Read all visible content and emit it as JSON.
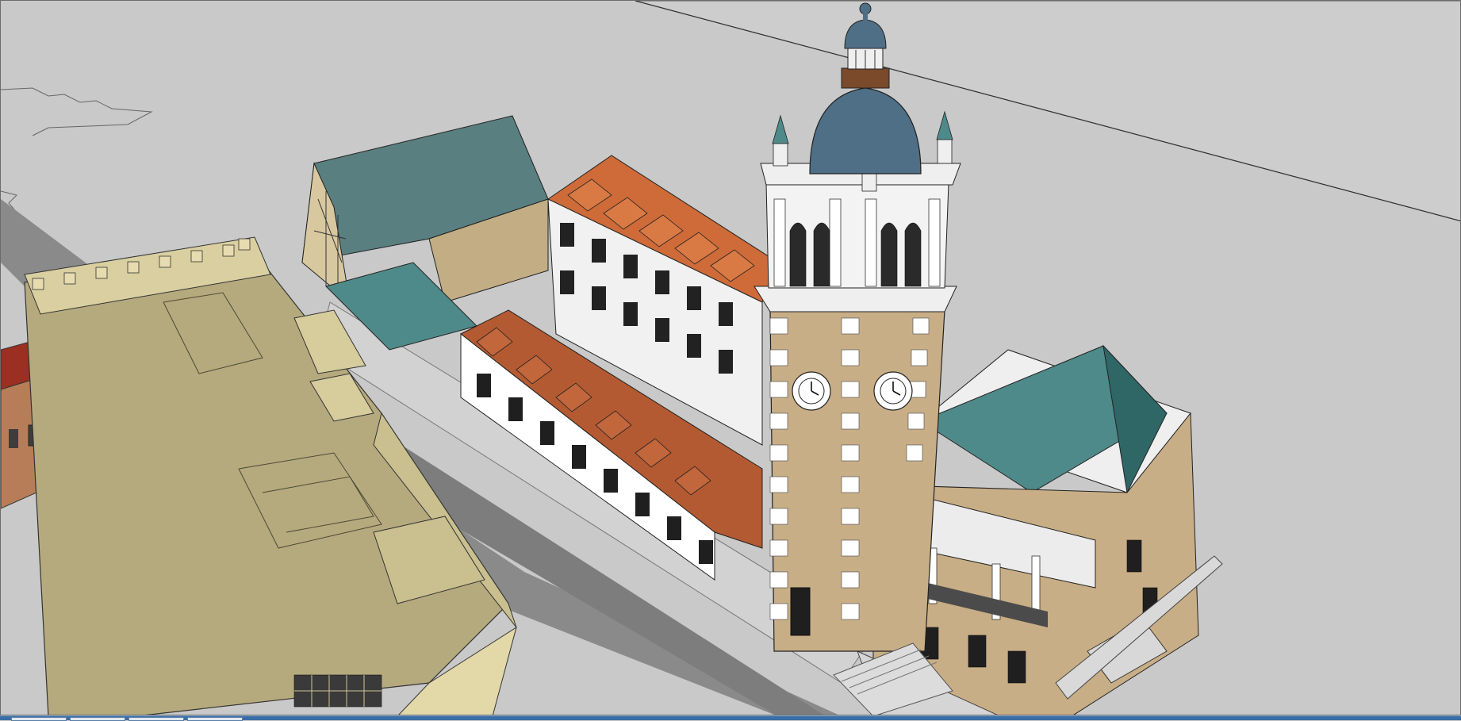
{
  "app": {
    "title": ""
  },
  "scene": {
    "tower": {
      "clock_count": 2,
      "dome_color": "#4f6f86"
    },
    "colors": {
      "ground": "#c9c9c9",
      "road": "#8a8a8a",
      "stucco": "#c8ae86",
      "flat_roof": "#b5aa7e",
      "red_roof": "#b45a32",
      "teal_roof": "#4f8a8a",
      "white_trim": "#ececec"
    }
  },
  "taskbar": {
    "buttons": [
      "",
      "",
      "",
      ""
    ]
  }
}
